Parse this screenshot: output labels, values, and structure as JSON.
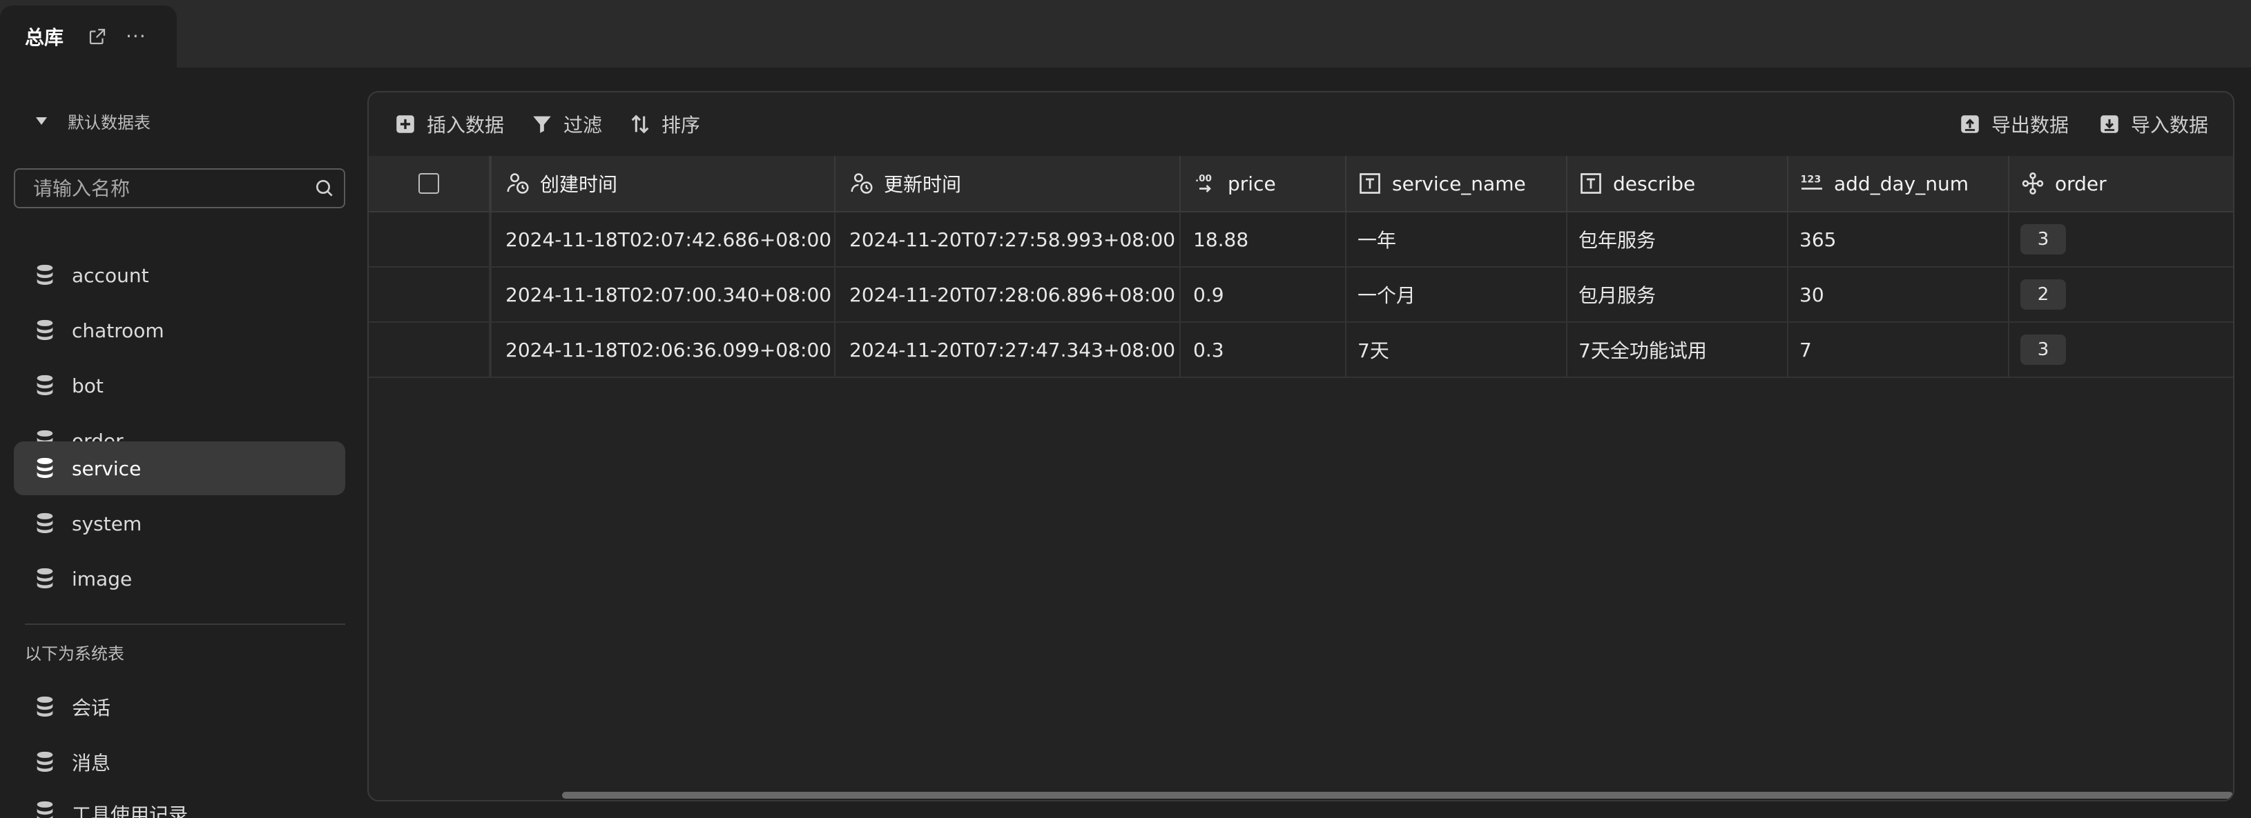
{
  "tab": {
    "title": "总库",
    "more": "···",
    "external_icon": "external-link-icon"
  },
  "sidebar": {
    "section_label": "默认数据表",
    "search_placeholder": "请输入名称",
    "items": [
      {
        "label": "account"
      },
      {
        "label": "chatroom"
      },
      {
        "label": "bot"
      },
      {
        "label": "order"
      },
      {
        "label": "service",
        "active": true
      },
      {
        "label": "system"
      },
      {
        "label": "image"
      }
    ],
    "system_label": "以下为系统表",
    "system_items": [
      {
        "label": "会话"
      },
      {
        "label": "消息"
      },
      {
        "label": "工具使用记录"
      }
    ]
  },
  "toolbar": {
    "insert": "插入数据",
    "filter": "过滤",
    "sort": "排序",
    "export": "导出数据",
    "import": "导入数据"
  },
  "table": {
    "columns": [
      "创建时间",
      "更新时间",
      "price",
      "service_name",
      "describe",
      "add_day_num",
      "order"
    ],
    "rows": [
      [
        "2024-11-18T02:07:42.686+08:00",
        "2024-11-20T07:27:58.993+08:00",
        "18.88",
        "一年",
        "包年服务",
        "365",
        "3"
      ],
      [
        "2024-11-18T02:07:00.340+08:00",
        "2024-11-20T07:28:06.896+08:00",
        "0.9",
        "一个月",
        "包月服务",
        "30",
        "2"
      ],
      [
        "2024-11-18T02:06:36.099+08:00",
        "2024-11-20T07:27:47.343+08:00",
        "0.3",
        "7天",
        "7天全功能试用",
        "7",
        "3"
      ]
    ]
  },
  "colors": {
    "background": "#1f1f1f",
    "active_item": "#3a3a3a",
    "panel": "#232323"
  }
}
